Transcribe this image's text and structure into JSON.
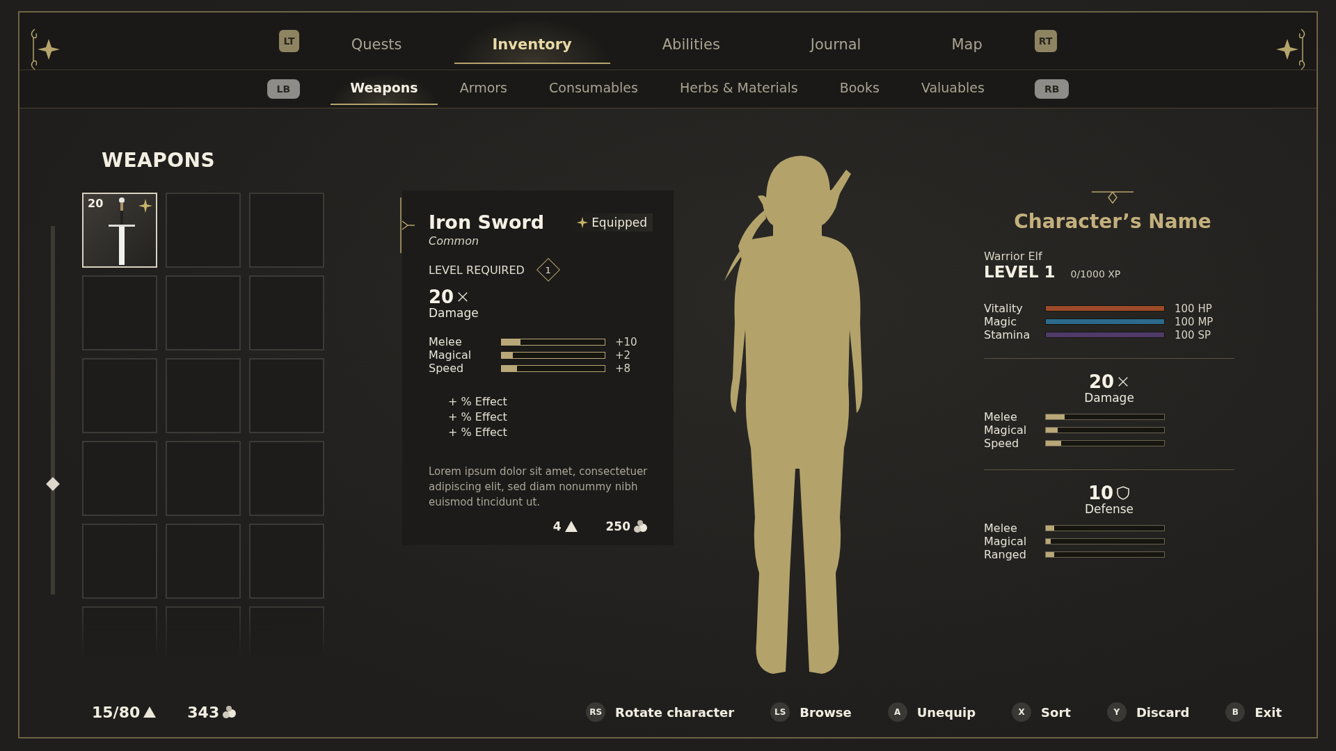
{
  "nav": {
    "left_bumper": "LT",
    "right_bumper": "RT",
    "tabs": [
      {
        "label": "Quests",
        "selected": false
      },
      {
        "label": "Inventory",
        "selected": true
      },
      {
        "label": "Abilities",
        "selected": false
      },
      {
        "label": "Journal",
        "selected": false
      },
      {
        "label": "Map",
        "selected": false
      }
    ]
  },
  "sub_nav": {
    "left_bumper": "LB",
    "right_bumper": "RB",
    "tabs": [
      {
        "label": "Weapons",
        "selected": true
      },
      {
        "label": "Armors",
        "selected": false
      },
      {
        "label": "Consumables",
        "selected": false
      },
      {
        "label": "Herbs & Materials",
        "selected": false
      },
      {
        "label": "Books",
        "selected": false
      },
      {
        "label": "Valuables",
        "selected": false
      }
    ]
  },
  "section_title": "WEAPONS",
  "slots": [
    {
      "kind": "sword",
      "count": "20",
      "equipped": true,
      "selected": true
    },
    {
      "kind": "empty",
      "selected": false
    },
    {
      "kind": "empty",
      "selected": false
    },
    {
      "kind": "empty",
      "selected": false
    },
    {
      "kind": "empty",
      "selected": false
    },
    {
      "kind": "empty",
      "selected": false
    },
    {
      "kind": "empty",
      "selected": false
    },
    {
      "kind": "empty",
      "selected": false
    },
    {
      "kind": "empty",
      "selected": false
    },
    {
      "kind": "empty",
      "selected": false
    },
    {
      "kind": "empty",
      "selected": false
    },
    {
      "kind": "empty",
      "selected": false
    },
    {
      "kind": "empty",
      "selected": false
    },
    {
      "kind": "empty",
      "selected": false
    },
    {
      "kind": "empty",
      "selected": false
    },
    {
      "kind": "empty",
      "selected": false
    },
    {
      "kind": "empty",
      "selected": false
    },
    {
      "kind": "empty",
      "selected": false
    }
  ],
  "item": {
    "name": "Iron Sword",
    "rarity": "Common",
    "equipped_label": "Equipped",
    "level_required_label": "LEVEL REQUIRED",
    "level_required": "1",
    "damage": "20",
    "damage_label": "Damage",
    "stats": [
      {
        "name": "Melee",
        "level": 0.18,
        "reading": "+10"
      },
      {
        "name": "Magical",
        "level": 0.11,
        "reading": "+2"
      },
      {
        "name": "Speed",
        "level": 0.15,
        "reading": "+8"
      }
    ],
    "effects": [
      "+ % Effect",
      "+ % Effect",
      "+ % Effect"
    ],
    "description": "Lorem ipsum dolor sit amet, consectetuer adipiscing elit, sed diam nonummy nibh euismod tincidunt ut.",
    "weight": "4",
    "price": "250"
  },
  "character": {
    "name": "Character’s Name",
    "class": "Warrior Elf",
    "level": "LEVEL 1",
    "xp": "0/1000 XP",
    "vitals": [
      {
        "name": "Vitality",
        "level": 1,
        "reading": "100 HP",
        "color": "#9c4a28"
      },
      {
        "name": "Magic",
        "level": 1,
        "reading": "100 MP",
        "color": "#2b6a8c"
      },
      {
        "name": "Stamina",
        "level": 1,
        "reading": "100 SP",
        "color": "#4f3a68"
      }
    ],
    "damage": {
      "value": "20",
      "label": "Damage",
      "stats": [
        {
          "name": "Melee",
          "level": 0.16
        },
        {
          "name": "Magical",
          "level": 0.1
        },
        {
          "name": "Speed",
          "level": 0.13
        }
      ]
    },
    "defense": {
      "value": "10",
      "label": "Defense",
      "stats": [
        {
          "name": "Melee",
          "level": 0.07
        },
        {
          "name": "Magical",
          "level": 0.04
        },
        {
          "name": "Ranged",
          "level": 0.07
        }
      ]
    }
  },
  "footer": {
    "capacity": "15/80",
    "coins": "343",
    "actions": [
      {
        "key": "RS",
        "label": "Rotate character"
      },
      {
        "key": "LS",
        "label": "Browse"
      },
      {
        "key": "A",
        "label": "Unequip"
      },
      {
        "key": "X",
        "label": "Sort"
      },
      {
        "key": "Y",
        "label": "Discard"
      },
      {
        "key": "B",
        "label": "Exit"
      }
    ]
  }
}
